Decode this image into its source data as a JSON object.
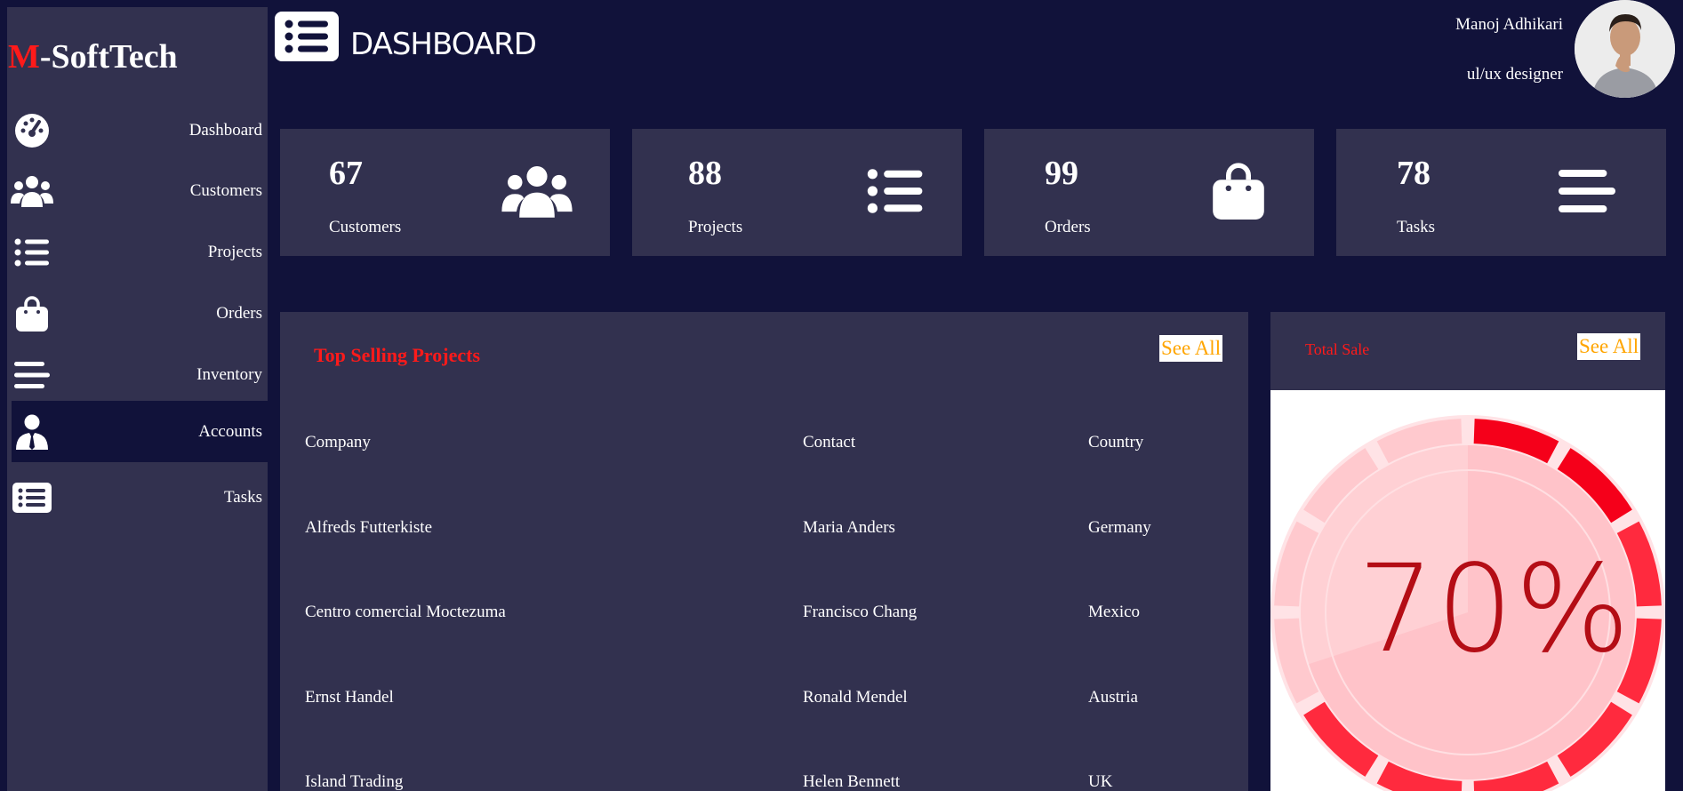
{
  "brand": {
    "prefix": "M",
    "rest": "-SoftTech"
  },
  "sidebar": {
    "items": [
      {
        "label": "Dashboard",
        "icon": "dashboard-gauge-icon",
        "active": false
      },
      {
        "label": "Customers",
        "icon": "users-icon",
        "active": false
      },
      {
        "label": "Projects",
        "icon": "list-icon",
        "active": false
      },
      {
        "label": "Orders",
        "icon": "shopping-bag-icon",
        "active": false
      },
      {
        "label": "Inventory",
        "icon": "bars-icon",
        "active": false
      },
      {
        "label": "Accounts",
        "icon": "user-tie-icon",
        "active": true
      },
      {
        "label": "Tasks",
        "icon": "task-list-icon",
        "active": false
      }
    ]
  },
  "header": {
    "title": "DASHBOARD",
    "icon": "list-icon"
  },
  "user": {
    "name": "Manoj Adhikari",
    "role": "ul/ux designer"
  },
  "cards": [
    {
      "value": "67",
      "label": "Customers",
      "icon": "users-icon"
    },
    {
      "value": "88",
      "label": "Projects",
      "icon": "list-icon"
    },
    {
      "value": "99",
      "label": "Orders",
      "icon": "shopping-bag-icon"
    },
    {
      "value": "78",
      "label": "Tasks",
      "icon": "bars-icon"
    }
  ],
  "projects": {
    "title": "Top Selling Projects",
    "see_all": "See All",
    "columns": [
      "Company",
      "Contact",
      "Country"
    ],
    "rows": [
      [
        "Alfreds Futterkiste",
        "Maria Anders",
        "Germany"
      ],
      [
        "Centro comercial Moctezuma",
        "Francisco Chang",
        "Mexico"
      ],
      [
        "Ernst Handel",
        "Ronald Mendel",
        "Austria"
      ],
      [
        "Island Trading",
        "Helen Bennett",
        "UK"
      ]
    ]
  },
  "sales": {
    "title": "Total Sale",
    "see_all": "See All",
    "gauge_text": "70%",
    "gauge_value": 0.7
  },
  "colors": {
    "background": "#11123a",
    "panel": "#32314f",
    "accent_red": "#ff1a1a",
    "see_all": "#ffa500"
  }
}
